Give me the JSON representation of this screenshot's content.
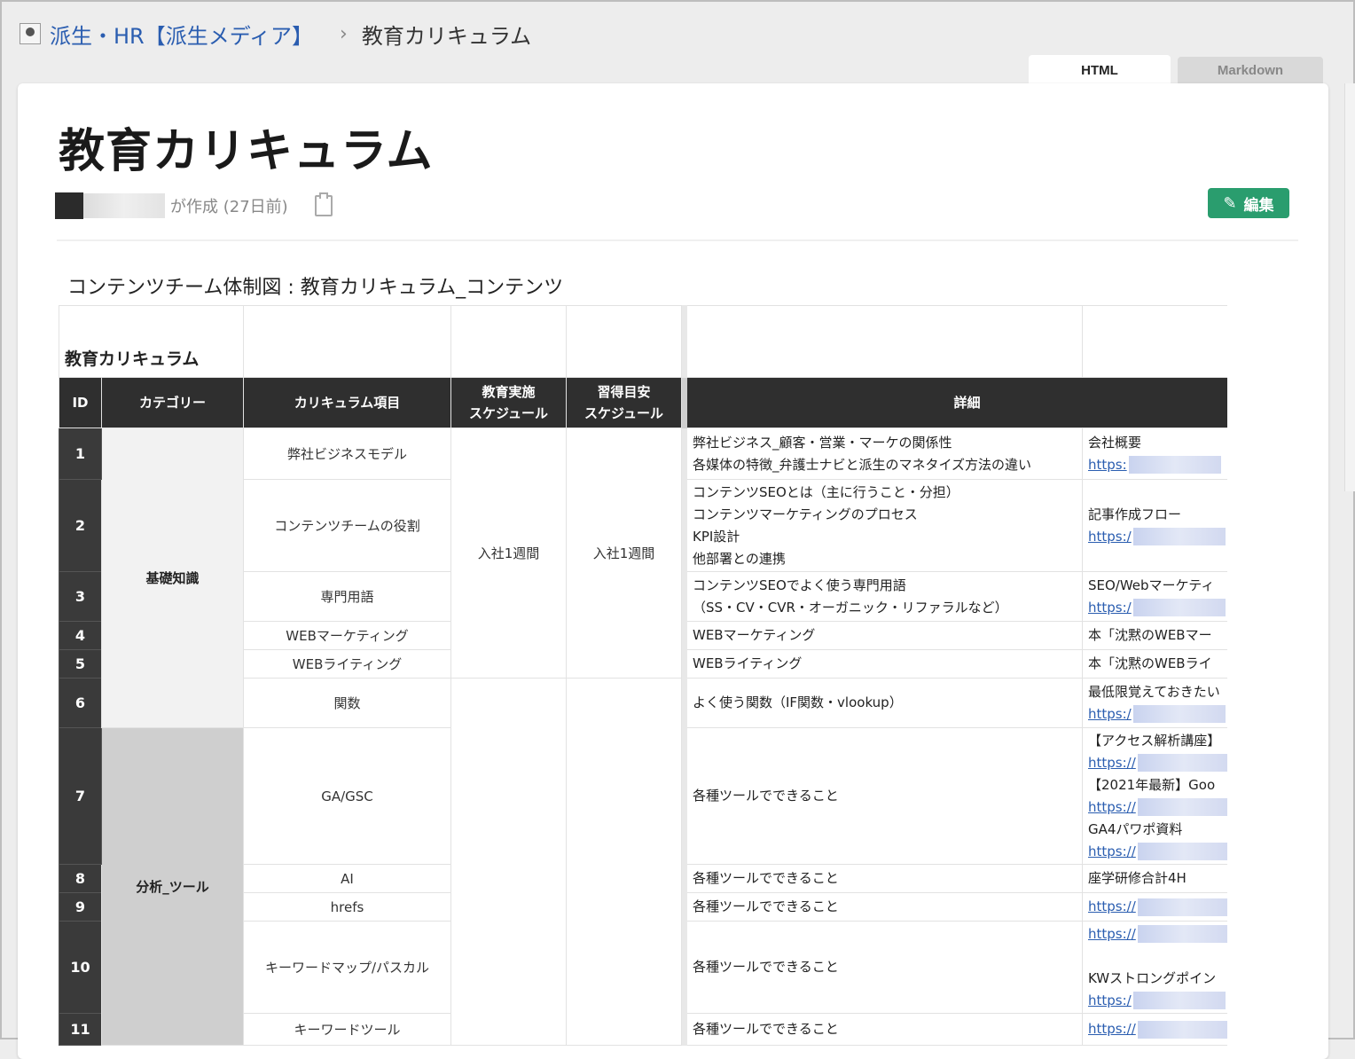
{
  "breadcrumb": {
    "parent": "派生・HR【派生メディア】",
    "separator": "›",
    "current": "教育カリキュラム"
  },
  "tabs": {
    "html": "HTML",
    "markdown": "Markdown"
  },
  "page": {
    "title": "教育カリキュラム",
    "author_suffix": "が作成 (27日前)",
    "edit_label": "編集"
  },
  "sheet": {
    "caption": "コンテンツチーム体制図 : 教育カリキュラム_コンテンツ",
    "title": "教育カリキュラム",
    "headers": {
      "id": "ID",
      "category": "カテゴリー",
      "item": "カリキュラム項目",
      "edu": "教育実施\nスケジュール",
      "goal": "習得目安\nスケジュール",
      "detail": "詳細"
    },
    "categories": {
      "basic": "基礎知識",
      "tool": "分析_ツール"
    },
    "schedule": {
      "edu": "入社1週間",
      "goal": "入社1週間"
    },
    "rows": [
      {
        "id": "1",
        "item": "弊社ビジネスモデル",
        "detail": [
          "弊社ビジネス_顧客・営業・マーケの関係性",
          "各媒体の特徴_弁護士ナビと派生のマネタイズ方法の違い"
        ],
        "ref": [
          {
            "t": "会社概要"
          },
          {
            "l": "https:"
          }
        ]
      },
      {
        "id": "2",
        "item": "コンテンツチームの役割",
        "detail": [
          "コンテンツSEOとは（主に行うこと・分担）",
          "コンテンツマーケティングのプロセス",
          "KPI設計",
          "他部署との連携"
        ],
        "ref": [
          {
            "t": "記事作成フロー"
          },
          {
            "l": "https:/"
          }
        ]
      },
      {
        "id": "3",
        "item": "専門用語",
        "detail": [
          "コンテンツSEOでよく使う専門用語",
          "（SS・CV・CVR・オーガニック・リファラルなど）"
        ],
        "ref": [
          {
            "t": "SEO/Webマーケティ"
          },
          {
            "l": "https:/"
          }
        ]
      },
      {
        "id": "4",
        "item": "WEBマーケティング",
        "detail": [
          "WEBマーケティング"
        ],
        "ref": [
          {
            "t": "本「沈黙のWEBマー"
          }
        ]
      },
      {
        "id": "5",
        "item": "WEBライティング",
        "detail": [
          "WEBライティング"
        ],
        "ref": [
          {
            "t": "本「沈黙のWEBライ"
          }
        ]
      },
      {
        "id": "6",
        "item": "関数",
        "detail": [
          "よく使う関数（IF関数・vlookup）"
        ],
        "ref": [
          {
            "t": "最低限覚えておきたい"
          },
          {
            "l": "https:/"
          }
        ]
      },
      {
        "id": "7",
        "item": "GA/GSC",
        "detail": [
          "各種ツールでできること"
        ],
        "ref": [
          {
            "t": "【アクセス解析講座】"
          },
          {
            "l": "https://"
          },
          {
            "t": "【2021年最新】Goo"
          },
          {
            "l": "https://"
          },
          {
            "t": "GA4パワポ資料"
          },
          {
            "l": "https://"
          }
        ]
      },
      {
        "id": "8",
        "item": "AI",
        "detail": [
          "各種ツールでできること"
        ],
        "ref": [
          {
            "t": "座学研修合計4H"
          }
        ]
      },
      {
        "id": "9",
        "item": "hrefs",
        "detail": [
          "各種ツールでできること"
        ],
        "ref": [
          {
            "l": "https://"
          }
        ]
      },
      {
        "id": "10",
        "item": "キーワードマップ/パスカル",
        "detail": [
          "各種ツールでできること"
        ],
        "ref": [
          {
            "l": "https://"
          },
          {
            "t": ""
          },
          {
            "t": "KWストロングポイン"
          },
          {
            "l": "https:/"
          }
        ]
      },
      {
        "id": "11",
        "item": "キーワードツール",
        "detail": [
          "各種ツールでできること"
        ],
        "ref": [
          {
            "l": "https://"
          }
        ]
      }
    ]
  }
}
